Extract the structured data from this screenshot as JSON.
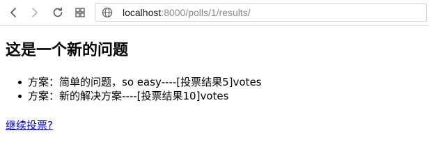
{
  "browser": {
    "url_host": "localhost",
    "url_rest": ":8000/polls/1/results/",
    "icons": {
      "back": "arrow-left-icon",
      "forward": "arrow-right-icon",
      "reload": "reload-icon",
      "apps": "apps-grid-icon",
      "site": "globe-icon"
    }
  },
  "page": {
    "question_title": "这是一个新的问题",
    "choices": [
      {
        "text": "方案：简单的问题，so easy----[投票结果5]votes"
      },
      {
        "text": "方案：新的解决方案----[投票结果10]votes"
      }
    ],
    "vote_again_link": "继续投票?"
  }
}
